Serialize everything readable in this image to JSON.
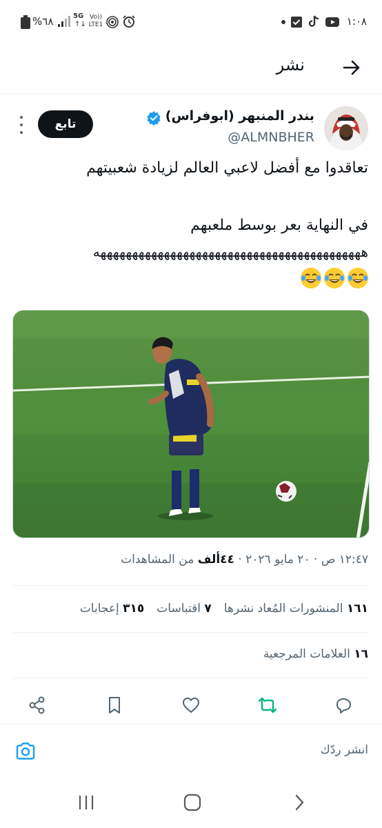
{
  "status_bar": {
    "time": "١:٠٨",
    "battery": "%٦٨",
    "network_5g": "5G",
    "volte": "Vo)) LTE1"
  },
  "header": {
    "title": "نشر",
    "back_icon": "arrow-right-icon"
  },
  "tweet": {
    "author_name": "بندر المنبهر (ابوفراس)",
    "handle": "@ALMNBHER",
    "follow_label": "تابع",
    "text_line1": "تعاقدوا مع أفضل لاعبي العالم لزيادة شعبيتهم",
    "text_line2": "في النهاية بعر بوسط ملعبهم",
    "text_line3": "ههههههههههههههههههههههههههههههههههههههههههه",
    "emoji_count": 3,
    "timestamp": "١٢:٤٧ ص · ٢٠ مايو ٢٠٢٦ · ",
    "views_count": "٤٤ألف",
    "views_label": " من المشاهدات",
    "reposts_count": "١٦١",
    "reposts_label": "المنشورات المُعاد نشرها",
    "quotes_count": "٧",
    "quotes_label": "اقتباسات",
    "likes_count": "٣١٥",
    "likes_label": "إعجابات",
    "bookmarks_count": "١٦",
    "bookmarks_label": "العلامات المرجعية"
  },
  "reply": {
    "placeholder": "انشر ردّك"
  },
  "colors": {
    "accent": "#1d9bf0",
    "repost_green": "#00ba7c",
    "text_primary": "#0f1419",
    "text_secondary": "#536471",
    "field_green": "#4b8a3a"
  }
}
